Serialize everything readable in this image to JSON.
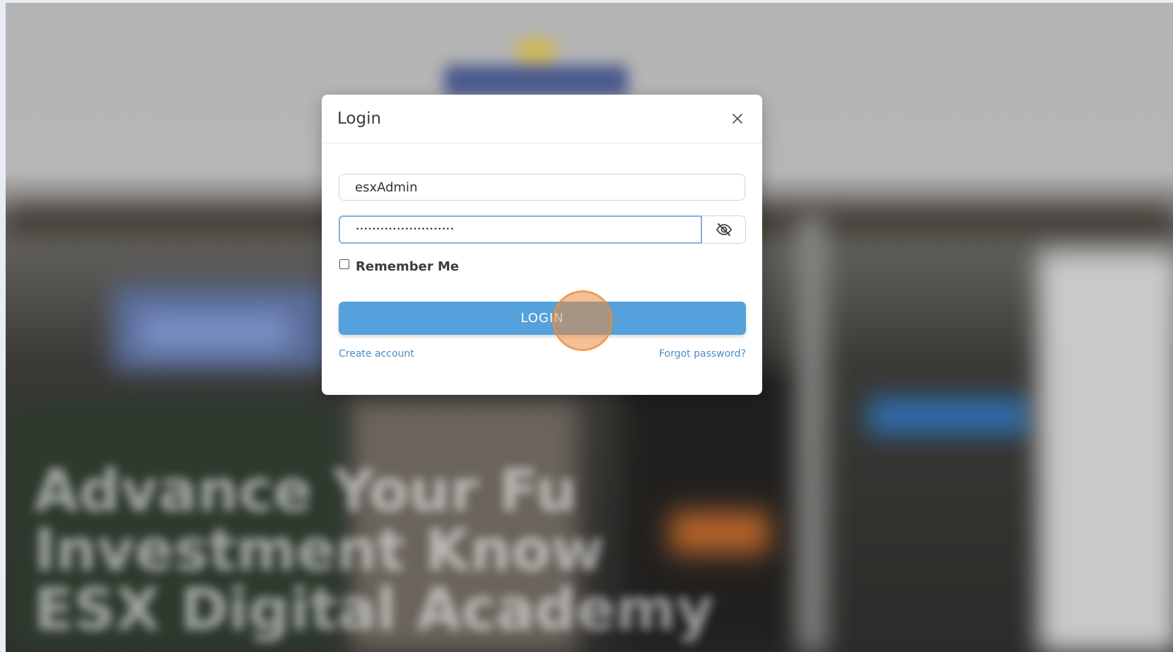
{
  "background": {
    "headline_lines": [
      "Advance Your Fu",
      "Investment Know",
      "ESX Digital Academy"
    ]
  },
  "modal": {
    "title": "Login",
    "close_icon": "close-icon",
    "username_value": "esxAdmin",
    "password_mask": "••••••••••••••••••••••••",
    "eye_icon": "eye-off-icon",
    "remember_label": "Remember Me",
    "remember_checked": false,
    "login_label": "LOGIN",
    "create_account": "Create account",
    "forgot_password": "Forgot password?"
  },
  "colors": {
    "primary_button": "#55a1db",
    "link": "#4a8cc4",
    "focus_border": "#7fb0e0",
    "click_indicator": "#eb8c3c"
  }
}
